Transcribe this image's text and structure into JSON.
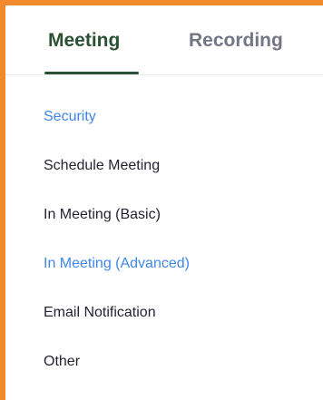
{
  "tabs": [
    {
      "label": "Meeting",
      "active": true
    },
    {
      "label": "Recording",
      "active": false
    }
  ],
  "menu": [
    {
      "label": "Security",
      "highlighted": true
    },
    {
      "label": "Schedule Meeting",
      "highlighted": false
    },
    {
      "label": "In Meeting (Basic)",
      "highlighted": false
    },
    {
      "label": "In Meeting (Advanced)",
      "highlighted": true
    },
    {
      "label": "Email Notification",
      "highlighted": false
    },
    {
      "label": "Other",
      "highlighted": false
    }
  ],
  "colors": {
    "frame_border": "#f08a2c",
    "active_tab": "#2b5135",
    "inactive_tab": "#747487",
    "link_blue": "#3e86e8",
    "text": "#232333"
  }
}
